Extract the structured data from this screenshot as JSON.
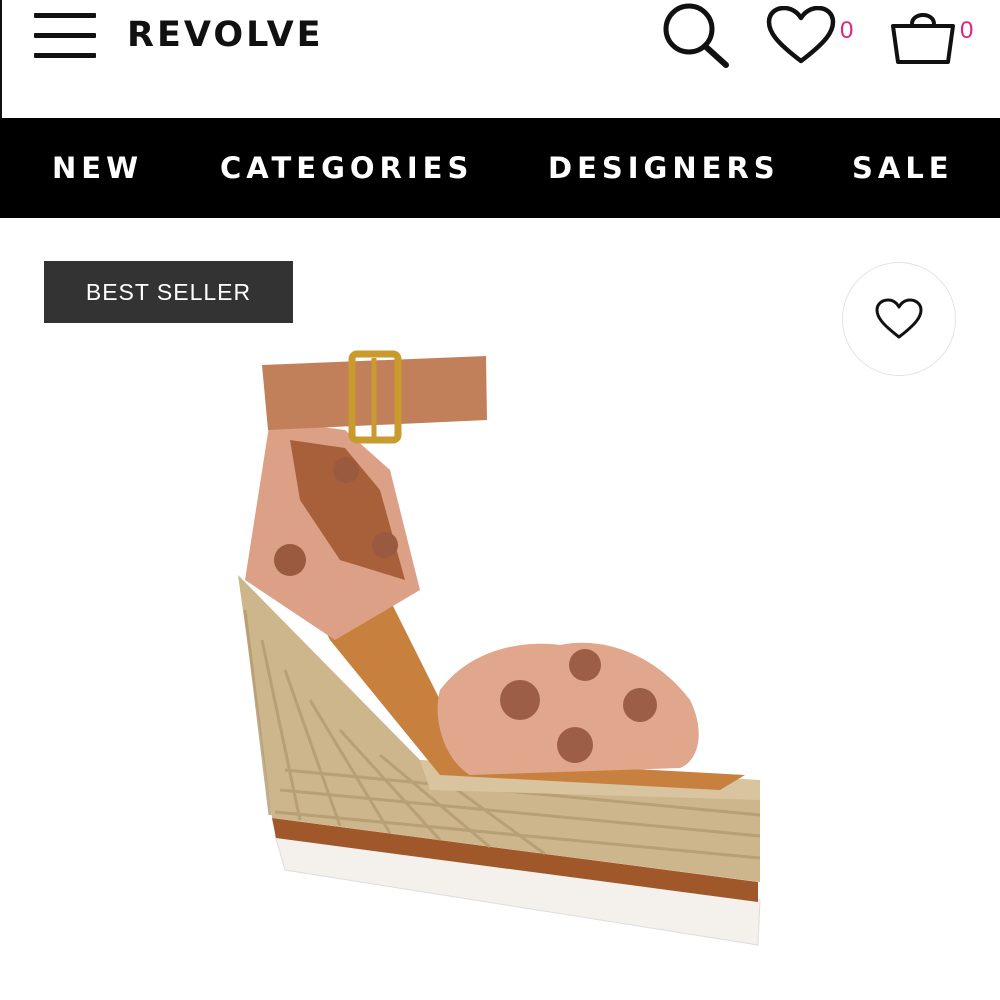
{
  "header": {
    "logo": "REVOLVE",
    "wishlist_count": "0",
    "bag_count": "0",
    "icons": {
      "menu": "hamburger-menu-icon",
      "search": "search-icon",
      "wishlist": "heart-icon",
      "bag": "shopping-bag-icon"
    }
  },
  "nav": {
    "items": [
      "NEW",
      "CATEGORIES",
      "DESIGNERS",
      "SALE"
    ]
  },
  "product": {
    "badge": "BEST SELLER",
    "favorite_icon": "heart-outline-icon",
    "image_subject": "espadrille-wedge-sandal"
  },
  "colors": {
    "accent_count": "#e0218a",
    "navbar_bg": "#000000",
    "badge_bg": "#333333"
  }
}
